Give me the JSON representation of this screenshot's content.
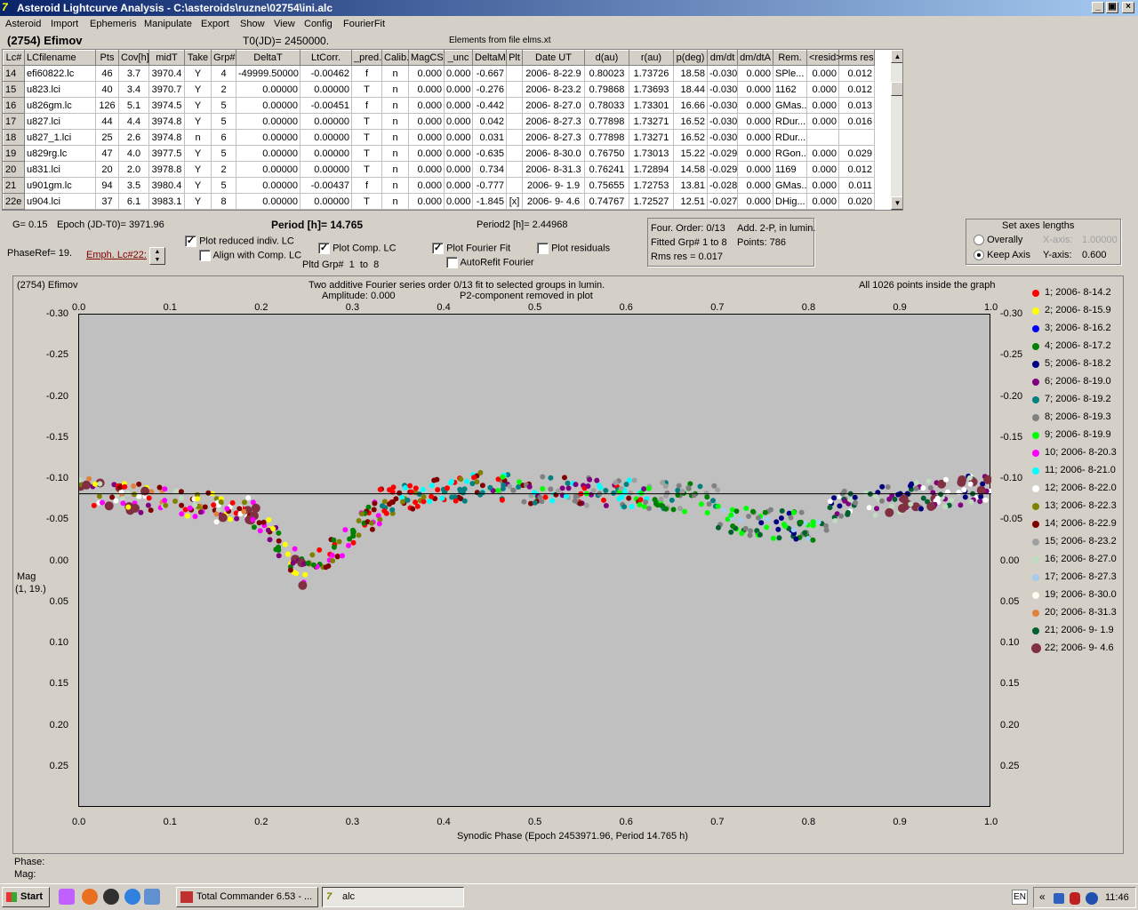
{
  "window": {
    "title": "Asteroid Lightcurve Analysis - C:\\asteroids\\ruzne\\02754\\ini.alc",
    "buttons": [
      "_",
      "▣",
      "×"
    ]
  },
  "menu": [
    "Asteroid",
    "Import",
    "Ephemeris",
    "Manipulate",
    "Export",
    "Show",
    "View",
    "Config",
    "FourierFit"
  ],
  "header": {
    "object": "(2754) Efimov",
    "t0": "T0(JD)= 2450000.",
    "elements": "Elements from file elms.xt"
  },
  "table": {
    "columns": [
      "Lc#",
      "LCfilename",
      "Pts",
      "Cov[h]",
      "midT",
      "Take",
      "Grp#",
      "DeltaT",
      "LtCorr.",
      "_pred.",
      "Calib.",
      "MagCS",
      "_unc",
      "DeltaM",
      "Plt",
      "Date UT",
      "d(au)",
      "r(au)",
      "p(deg)",
      "dm/dt",
      "dm/dtA",
      "Rem.",
      "<resid>",
      "rms res"
    ],
    "rows": [
      [
        "14",
        "efi60822.lc",
        "46",
        "3.7",
        "3970.4",
        "Y",
        "4",
        "-49999.50000",
        "-0.00462",
        "f",
        "n",
        "0.000",
        "0.000",
        "-0.667",
        "",
        "2006- 8-22.9",
        "0.80023",
        "1.73726",
        "18.58",
        "-0.030",
        "0.000",
        "SPle...",
        "0.000",
        "0.012"
      ],
      [
        "15",
        "u823.lci",
        "40",
        "3.4",
        "3970.7",
        "Y",
        "2",
        "0.00000",
        "0.00000",
        "T",
        "n",
        "0.000",
        "0.000",
        "-0.276",
        "",
        "2006- 8-23.2",
        "0.79868",
        "1.73693",
        "18.44",
        "-0.030",
        "0.000",
        "1162",
        "0.000",
        "0.012"
      ],
      [
        "16",
        "u826gm.lc",
        "126",
        "5.1",
        "3974.5",
        "Y",
        "5",
        "0.00000",
        "-0.00451",
        "f",
        "n",
        "0.000",
        "0.000",
        "-0.442",
        "",
        "2006- 8-27.0",
        "0.78033",
        "1.73301",
        "16.66",
        "-0.030",
        "0.000",
        "GMas...",
        "0.000",
        "0.013"
      ],
      [
        "17",
        "u827.lci",
        "44",
        "4.4",
        "3974.8",
        "Y",
        "5",
        "0.00000",
        "0.00000",
        "T",
        "n",
        "0.000",
        "0.000",
        "0.042",
        "",
        "2006- 8-27.3",
        "0.77898",
        "1.73271",
        "16.52",
        "-0.030",
        "0.000",
        "RDur...",
        "0.000",
        "0.016"
      ],
      [
        "18",
        "u827_1.lci",
        "25",
        "2.6",
        "3974.8",
        "n",
        "6",
        "0.00000",
        "0.00000",
        "T",
        "n",
        "0.000",
        "0.000",
        "0.031",
        "",
        "2006- 8-27.3",
        "0.77898",
        "1.73271",
        "16.52",
        "-0.030",
        "0.000",
        "RDur...",
        "",
        ""
      ],
      [
        "19",
        "u829rg.lc",
        "47",
        "4.0",
        "3977.5",
        "Y",
        "5",
        "0.00000",
        "0.00000",
        "T",
        "n",
        "0.000",
        "0.000",
        "-0.635",
        "",
        "2006- 8-30.0",
        "0.76750",
        "1.73013",
        "15.22",
        "-0.029",
        "0.000",
        "RGon...",
        "0.000",
        "0.029"
      ],
      [
        "20",
        "u831.lci",
        "20",
        "2.0",
        "3978.8",
        "Y",
        "2",
        "0.00000",
        "0.00000",
        "T",
        "n",
        "0.000",
        "0.000",
        "0.734",
        "",
        "2006- 8-31.3",
        "0.76241",
        "1.72894",
        "14.58",
        "-0.029",
        "0.000",
        "1169",
        "0.000",
        "0.012"
      ],
      [
        "21",
        "u901gm.lc",
        "94",
        "3.5",
        "3980.4",
        "Y",
        "5",
        "0.00000",
        "-0.00437",
        "f",
        "n",
        "0.000",
        "0.000",
        "-0.777",
        "",
        "2006- 9- 1.9",
        "0.75655",
        "1.72753",
        "13.81",
        "-0.028",
        "0.000",
        "GMas...",
        "0.000",
        "0.011"
      ],
      [
        "22e",
        "u904.lci",
        "37",
        "6.1",
        "3983.1",
        "Y",
        "8",
        "0.00000",
        "0.00000",
        "T",
        "n",
        "0.000",
        "0.000",
        "-1.845",
        "[x]",
        "2006- 9- 4.6",
        "0.74767",
        "1.72527",
        "12.51",
        "-0.027",
        "0.000",
        "DHig...",
        "0.000",
        "0.020"
      ]
    ]
  },
  "controls": {
    "g": "G= 0.15",
    "epoch": "Epoch (JD-T0)= 3971.96",
    "period": "Period [h]= 14.765",
    "period2": "Period2 [h]= 2.44968",
    "phase_ref": "PhaseRef= 19.",
    "emph": "Emph. Lc#22:",
    "plot_reduced": "Plot reduced indiv. LC",
    "align_comp": "Align with Comp. LC",
    "plot_comp": "Plot Comp. LC",
    "pltd_grp": "Pltd Grp#",
    "pltd_from": "1",
    "pltd_to_word": "to",
    "pltd_to": "8",
    "plot_fourier": "Plot Fourier Fit",
    "autorefit": "AutoRefit Fourier",
    "plot_residuals": "Plot residuals",
    "fourier_info": {
      "order": "Four. Order: 0/13",
      "add": "Add. 2-P, in lumin.",
      "fitted": "Fitted Grp# 1 to 8",
      "points": "Points: 786",
      "rms": "Rms res       = 0.017"
    },
    "axes": {
      "title": "Set axes lengths",
      "overally": "Overally",
      "keep": "Keep Axis",
      "xaxis_label": "X-axis:",
      "xaxis_value": "1.00000",
      "yaxis_label": "Y-axis:",
      "yaxis_value": "0.600"
    }
  },
  "graph": {
    "object": "(2754) Efimov",
    "subtitle1": "Two additive Fourier series order 0/13 fit to selected groups in lumin.",
    "amplitude": "Amplitude: 0.000",
    "p2": "P2-component removed in plot",
    "points_note": "All 1026 points inside the graph",
    "ylabel": "Mag",
    "ylabel2": "(1, 19.)",
    "xlabel": "Synodic Phase (Epoch 2453971.96, Period 14.765 h)",
    "phase_label": "Phase:",
    "mag_label": "Mag:"
  },
  "chart_data": {
    "type": "scatter",
    "xlim": [
      0.0,
      1.0
    ],
    "ylim": [
      0.3,
      -0.3
    ],
    "x_ticks": [
      "0.0",
      "0.1",
      "0.2",
      "0.3",
      "0.4",
      "0.5",
      "0.6",
      "0.7",
      "0.8",
      "0.9",
      "1.0"
    ],
    "y_ticks": [
      "-0.30",
      "-0.25",
      "-0.20",
      "-0.15",
      "-0.10",
      "-0.05",
      "0.00",
      "0.05",
      "0.10",
      "0.15",
      "0.20",
      "0.25"
    ],
    "fit_line_y": -0.082,
    "legend": [
      {
        "label": "1; 2006- 8-14.2",
        "color": "#ff0000"
      },
      {
        "label": "2; 2006- 8-15.9",
        "color": "#ffff00"
      },
      {
        "label": "3; 2006- 8-16.2",
        "color": "#0000ff"
      },
      {
        "label": "4; 2006- 8-17.2",
        "color": "#008000"
      },
      {
        "label": "5; 2006- 8-18.2",
        "color": "#000080"
      },
      {
        "label": "6; 2006- 8-19.0",
        "color": "#800080"
      },
      {
        "label": "7; 2006- 8-19.2",
        "color": "#008080"
      },
      {
        "label": "8; 2006- 8-19.3",
        "color": "#808080"
      },
      {
        "label": "9; 2006- 8-19.9",
        "color": "#00ff00"
      },
      {
        "label": "10; 2006- 8-20.3",
        "color": "#ff00ff"
      },
      {
        "label": "11; 2006- 8-21.0",
        "color": "#00ffff"
      },
      {
        "label": "12; 2006- 8-22.0",
        "color": "#ffffff"
      },
      {
        "label": "13; 2006- 8-22.3",
        "color": "#808000"
      },
      {
        "label": "14; 2006- 8-22.9",
        "color": "#800000"
      },
      {
        "label": "15; 2006- 8-23.2",
        "color": "#a0a0a0"
      },
      {
        "label": "16; 2006- 8-27.0",
        "color": "#c0dcc0"
      },
      {
        "label": "17; 2006- 8-27.3",
        "color": "#a6caf0"
      },
      {
        "label": "19; 2006- 8-30.0",
        "color": "#fffbf0"
      },
      {
        "label": "20; 2006- 8-31.3",
        "color": "#e08040"
      },
      {
        "label": "21; 2006- 9- 1.9",
        "color": "#006030"
      },
      {
        "label": "22; 2006- 9- 4.6",
        "color": "#803040"
      }
    ],
    "segments": [
      {
        "x0": 0.0,
        "x1": 0.19,
        "y0": -0.085,
        "y1": -0.06,
        "colors": [
          "#ff0000",
          "#ffff00",
          "#800080",
          "#ff00ff",
          "#ffffff",
          "#808000",
          "#800000",
          "#803040",
          "#e08040",
          "#c0dcc0"
        ]
      },
      {
        "x0": 0.19,
        "x1": 0.25,
        "y0": -0.06,
        "y1": 0.02,
        "colors": [
          "#800080",
          "#ff00ff",
          "#ffff00",
          "#008000",
          "#800000",
          "#803040"
        ]
      },
      {
        "x0": 0.25,
        "x1": 0.33,
        "y0": 0.01,
        "y1": -0.06,
        "colors": [
          "#ff0000",
          "#808000",
          "#008000",
          "#800000",
          "#ff00ff"
        ]
      },
      {
        "x0": 0.33,
        "x1": 0.45,
        "y0": -0.07,
        "y1": -0.095,
        "colors": [
          "#ff0000",
          "#808000",
          "#800000",
          "#00ffff",
          "#008080"
        ]
      },
      {
        "x0": 0.45,
        "x1": 0.63,
        "y0": -0.09,
        "y1": -0.08,
        "colors": [
          "#00ffff",
          "#008080",
          "#ff0000",
          "#00ff00",
          "#808080",
          "#a0a0a0",
          "#800000",
          "#800080"
        ]
      },
      {
        "x0": 0.63,
        "x1": 0.7,
        "y0": -0.08,
        "y1": -0.075,
        "colors": [
          "#008000",
          "#00ff00",
          "#808080",
          "#a0a0a0",
          "#008080"
        ]
      },
      {
        "x0": 0.7,
        "x1": 0.82,
        "y0": -0.05,
        "y1": -0.04,
        "colors": [
          "#008000",
          "#00ff00",
          "#006030",
          "#000080",
          "#808080",
          "#a6caf0"
        ]
      },
      {
        "x0": 0.82,
        "x1": 1.0,
        "y0": -0.065,
        "y1": -0.09,
        "colors": [
          "#000080",
          "#800080",
          "#006030",
          "#ffffff",
          "#803040",
          "#c0dcc0",
          "#808080"
        ]
      }
    ]
  },
  "taskbar": {
    "start": "Start",
    "tasks": [
      "Total Commander 6.53 - ...",
      "alc"
    ],
    "lang": "EN",
    "clock": "11:46"
  }
}
